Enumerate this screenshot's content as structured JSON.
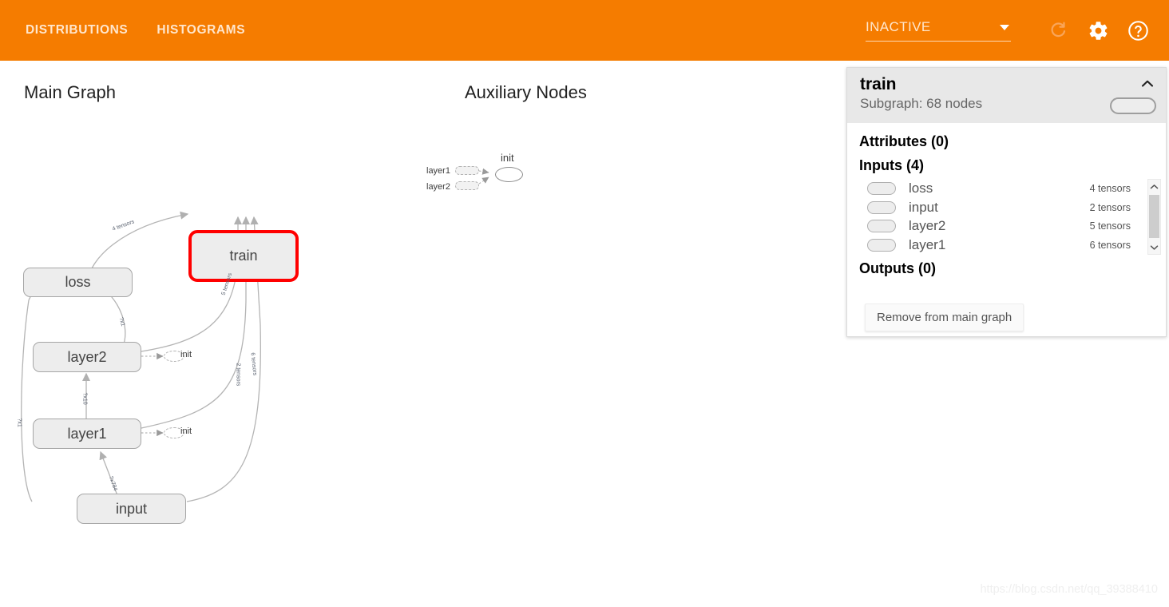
{
  "header": {
    "background_color": "#f57c00",
    "tabs": [
      {
        "label": "DISTRIBUTIONS",
        "name": "tab-distributions"
      },
      {
        "label": "HISTOGRAMS",
        "name": "tab-histograms"
      }
    ],
    "run_selector": {
      "value": "INACTIVE",
      "icon": "chevron-down-icon"
    },
    "icons": [
      {
        "name": "refresh-icon",
        "state": "disabled"
      },
      {
        "name": "gear-icon",
        "state": "enabled"
      },
      {
        "name": "help-icon",
        "state": "enabled"
      }
    ]
  },
  "graph": {
    "main_title": "Main Graph",
    "aux_title": "Auxiliary Nodes",
    "nodes": [
      {
        "label": "train",
        "selected": true
      },
      {
        "label": "loss",
        "selected": false
      },
      {
        "label": "layer2",
        "selected": false
      },
      {
        "label": "layer1",
        "selected": false
      },
      {
        "label": "input",
        "selected": false
      }
    ],
    "init_labels": [
      "init",
      "init"
    ],
    "edge_labels": [
      "4 tensors",
      "5 tensors",
      "2 tensors",
      "6 tensors",
      "?x1",
      "?x1",
      "?x1",
      "?x10",
      "?x784"
    ]
  },
  "aux_graph": {
    "stub_labels": [
      "layer1",
      "layer2"
    ],
    "init_label": "init"
  },
  "info_panel": {
    "title": "train",
    "subtitle": "Subgraph: 68 nodes",
    "collapse_icon": "chevron-up-icon",
    "attributes_heading": "Attributes (0)",
    "inputs_heading": "Inputs (4)",
    "outputs_heading": "Outputs (0)",
    "inputs": [
      {
        "name": "loss",
        "tensors": "4 tensors"
      },
      {
        "name": "input",
        "tensors": "2 tensors"
      },
      {
        "name": "layer2",
        "tensors": "5 tensors"
      },
      {
        "name": "layer1",
        "tensors": "6 tensors"
      }
    ],
    "remove_button": "Remove from main graph",
    "scrollbar": {
      "up_icon": "chevron-up-icon",
      "down_icon": "chevron-down-icon"
    }
  },
  "watermark": "https://blog.csdn.net/qq_39388410"
}
